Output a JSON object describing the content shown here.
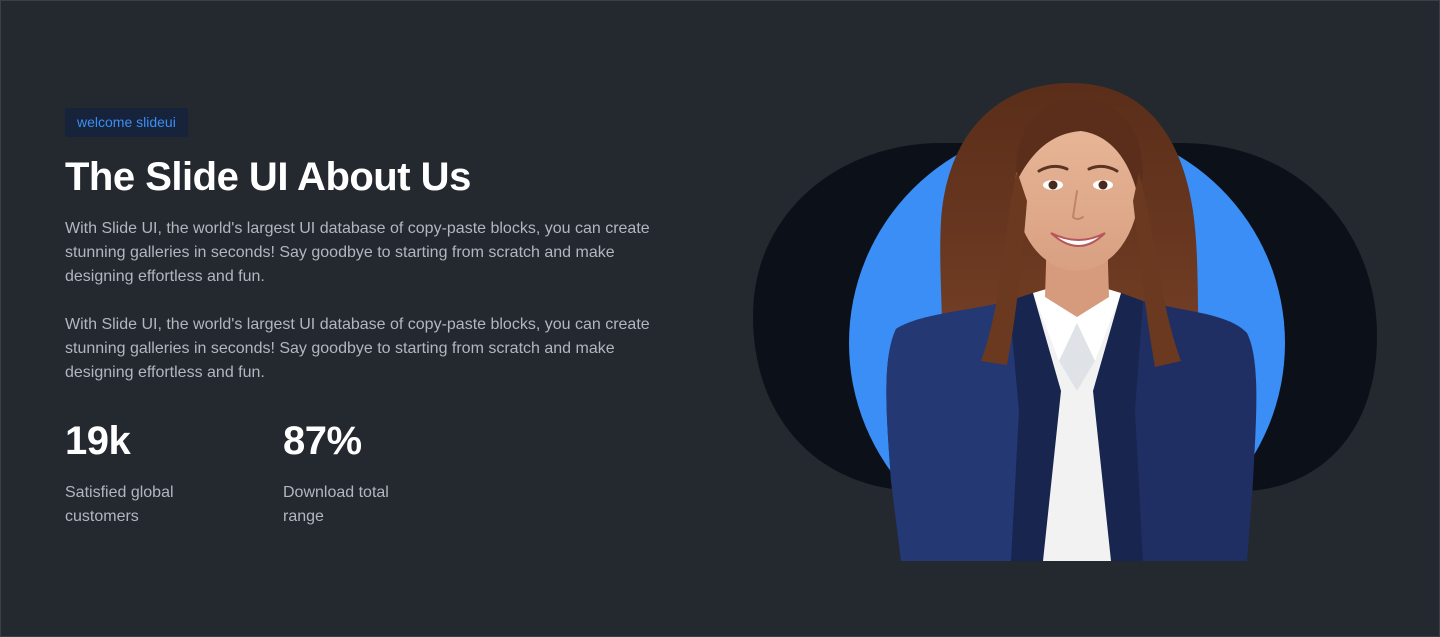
{
  "badge": "welcome slideui",
  "title": "The Slide UI About Us",
  "paragraphs": [
    "With Slide UI, the world's largest UI database of copy-paste blocks, you can create stunning galleries in seconds! Say goodbye to starting from scratch and make designing effortless and fun.",
    "With Slide UI, the world's largest UI database of copy-paste blocks, you can create stunning galleries in seconds! Say goodbye to starting from scratch and make designing effortless and fun."
  ],
  "stats": [
    {
      "value": "19k",
      "label": "Satisfied global customers"
    },
    {
      "value": "87%",
      "label": "Download total range"
    }
  ],
  "hero_image": {
    "subject": "smiling woman in navy blazer",
    "icon": "portrait-illustration"
  },
  "colors": {
    "background": "#23292f",
    "accent": "#3b8ef5",
    "badge_bg": "#16233a",
    "dark_shape": "#0c1119",
    "text_primary": "#ffffff",
    "text_secondary": "#b1b7bf"
  }
}
